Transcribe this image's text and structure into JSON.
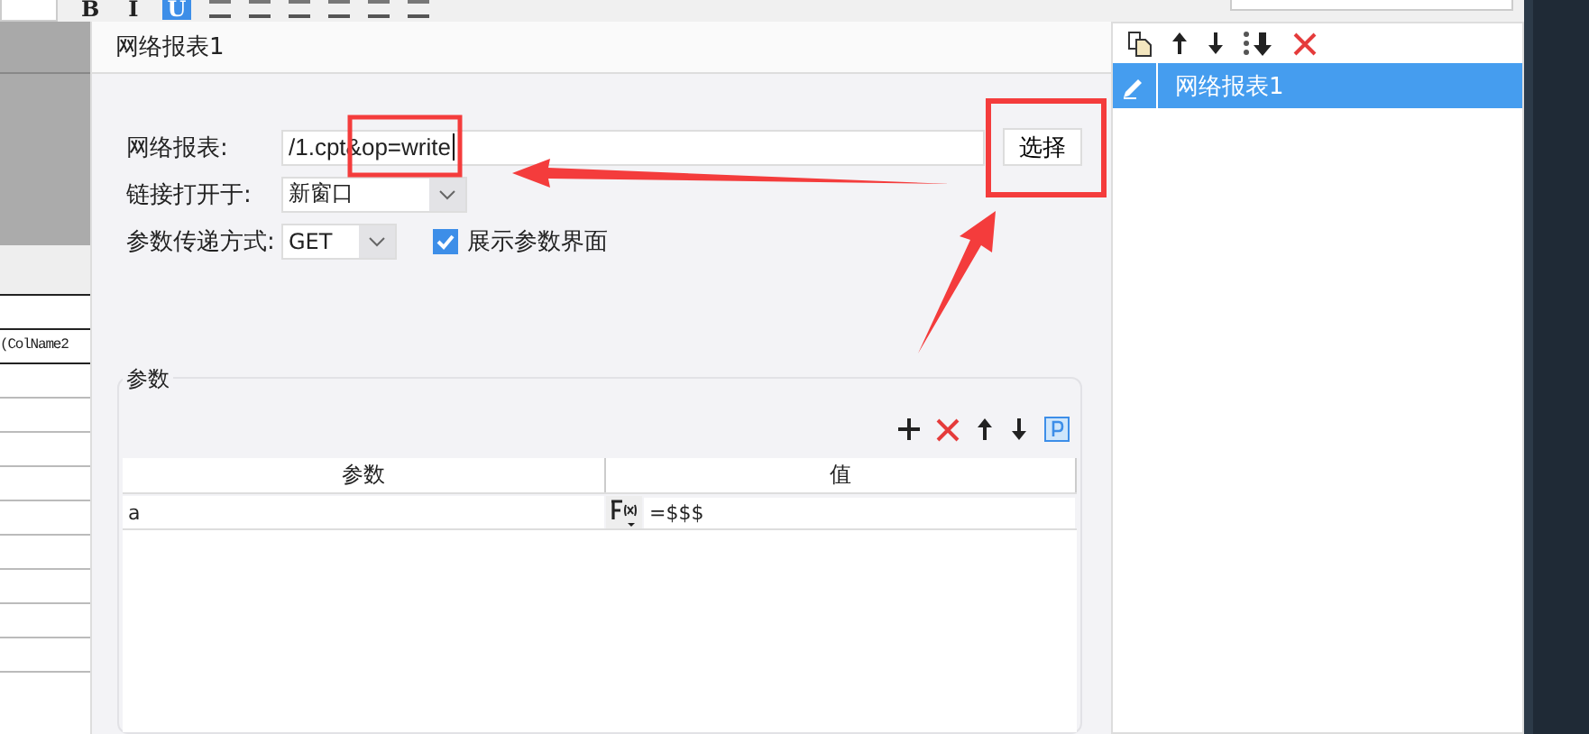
{
  "toolbar": {
    "font_buttons": [
      {
        "label": "B",
        "selected": false
      },
      {
        "label": "I",
        "selected": false
      },
      {
        "label": "U",
        "selected": true
      }
    ]
  },
  "sheet": {
    "cell_text": "(ColName2"
  },
  "dialog": {
    "title": "网络报表1",
    "fields": [
      {
        "kind": "text",
        "label": "网络报表:",
        "value": "/1.cpt&op=write",
        "button": "选择"
      },
      {
        "kind": "select",
        "label": "链接打开于:",
        "value": "新窗口"
      },
      {
        "kind": "select",
        "label": "参数传递方式:",
        "value": "GET",
        "checkbox": {
          "label": "展示参数界面",
          "checked": true
        }
      }
    ],
    "params": {
      "title": "参数",
      "columns": [
        "参数",
        "值"
      ],
      "rows": [
        {
          "name": "a",
          "value": "=$$$"
        }
      ]
    }
  },
  "list_panel": {
    "items": [
      {
        "label": "网络报表1",
        "selected": true
      }
    ]
  }
}
